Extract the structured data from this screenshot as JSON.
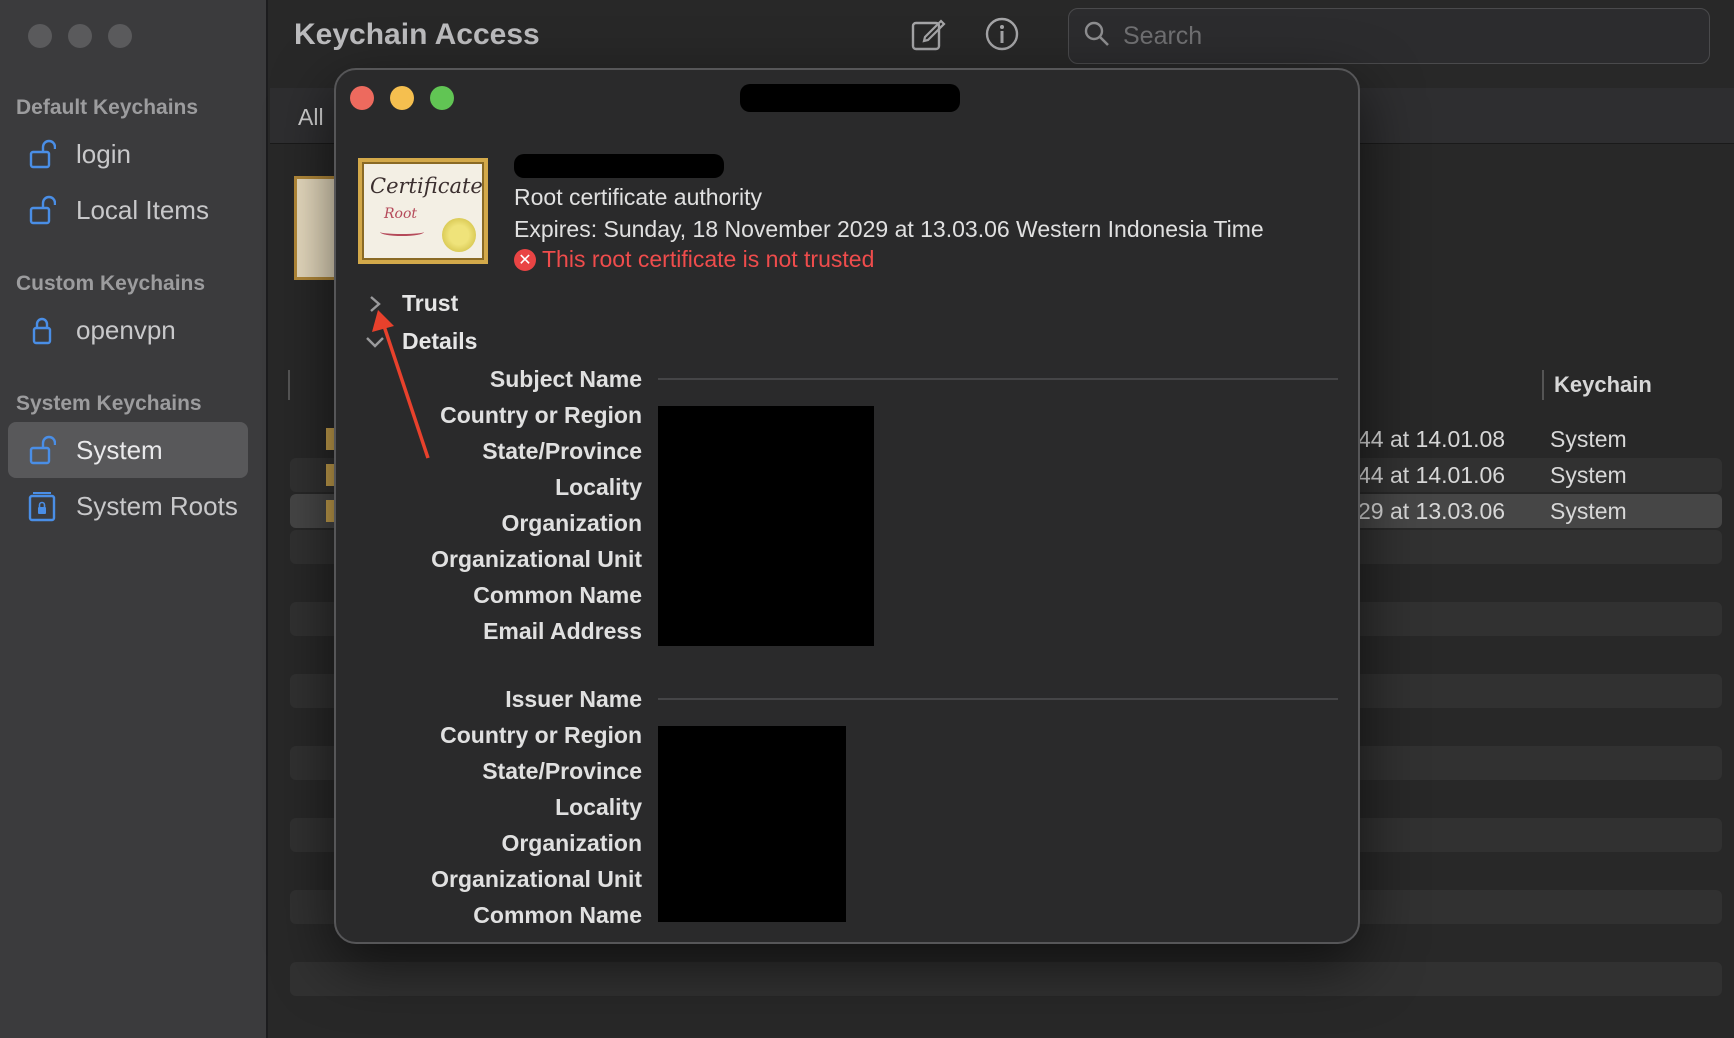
{
  "window": {
    "app_title": "Keychain Access",
    "search_placeholder": "Search",
    "filter_tab": "All"
  },
  "sidebar": {
    "sections": [
      {
        "title": "Default Keychains",
        "items": [
          {
            "label": "login",
            "icon": "lock-open-icon"
          },
          {
            "label": "Local Items",
            "icon": "lock-open-icon"
          }
        ]
      },
      {
        "title": "Custom Keychains",
        "items": [
          {
            "label": "openvpn",
            "icon": "lock-closed-icon"
          }
        ]
      },
      {
        "title": "System Keychains",
        "items": [
          {
            "label": "System",
            "icon": "lock-open-icon",
            "selected": true
          },
          {
            "label": "System Roots",
            "icon": "cabinet-lock-icon"
          }
        ]
      }
    ]
  },
  "table": {
    "columns": {
      "keychain": "Keychain"
    },
    "rows": [
      {
        "expires_fragment": "44 at 14.01.08",
        "keychain": "System"
      },
      {
        "expires_fragment": "44 at 14.01.06",
        "keychain": "System"
      },
      {
        "expires_fragment": "29 at 13.03.06",
        "keychain": "System",
        "selected": true
      }
    ]
  },
  "dialog": {
    "certificate_icon": {
      "title": "Certificate",
      "subtitle": "Root"
    },
    "cert_type": "Root certificate authority",
    "expires": "Expires: Sunday, 18 November 2029 at 13.03.06 Western Indonesia Time",
    "status": "This root certificate is not trusted",
    "sections": {
      "trust": "Trust",
      "details": "Details"
    },
    "subject_fields": {
      "group_title": "Subject Name",
      "labels": [
        "Country or Region",
        "State/Province",
        "Locality",
        "Organization",
        "Organizational Unit",
        "Common Name",
        "Email Address"
      ]
    },
    "issuer_fields": {
      "group_title": "Issuer Name",
      "labels": [
        "Country or Region",
        "State/Province",
        "Locality",
        "Organization",
        "Organizational Unit",
        "Common Name"
      ]
    }
  },
  "colors": {
    "close": "#ed6a5e",
    "minimize": "#f5bf4f",
    "zoom": "#61c554",
    "error": "#ef4c4c",
    "annotation_arrow": "#e8412c"
  }
}
